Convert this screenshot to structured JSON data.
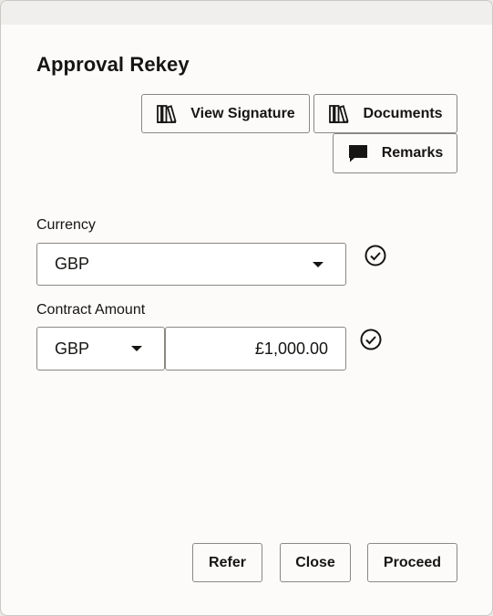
{
  "dialog": {
    "title": "Approval Rekey"
  },
  "toolbar": {
    "view_signature_label": "View Signature",
    "view_signature_icon": "books-icon",
    "documents_label": "Documents",
    "documents_icon": "books-icon",
    "remarks_label": "Remarks",
    "remarks_icon": "comment-icon"
  },
  "form": {
    "currency": {
      "label": "Currency",
      "value": "GBP",
      "status_icon": "check-circle-icon"
    },
    "contract_amount": {
      "label": "Contract Amount",
      "currency_value": "GBP",
      "amount_value": "£1,000.00",
      "status_icon": "check-circle-icon"
    }
  },
  "footer": {
    "refer_label": "Refer",
    "close_label": "Close",
    "proceed_label": "Proceed"
  }
}
